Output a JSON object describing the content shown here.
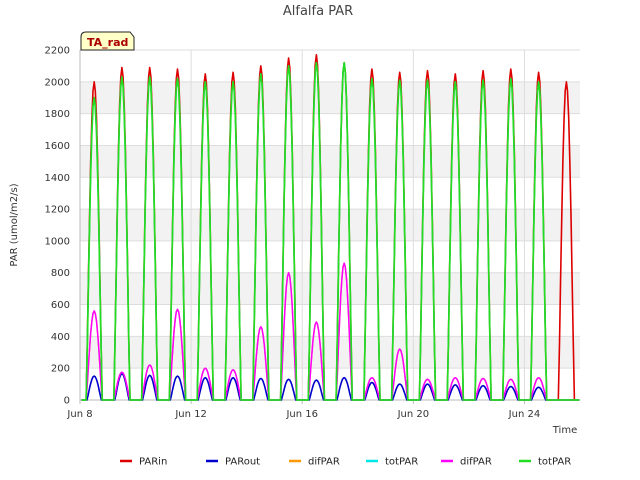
{
  "chart_data": {
    "type": "line",
    "title": "Alfalfa PAR",
    "xlabel": "Time",
    "ylabel": "PAR (umol/m2/s)",
    "badge": "TA_rad",
    "xlim": [
      "2024-06-08",
      "2024-06-26"
    ],
    "ylim": [
      0,
      2200
    ],
    "yticks": [
      0,
      200,
      400,
      600,
      800,
      1000,
      1200,
      1400,
      1600,
      1800,
      2000,
      2200
    ],
    "xticks": [
      {
        "date": "2024-06-08",
        "label": "Jun 8"
      },
      {
        "date": "2024-06-12",
        "label": "Jun 12"
      },
      {
        "date": "2024-06-16",
        "label": "Jun 16"
      },
      {
        "date": "2024-06-20",
        "label": "Jun 20"
      },
      {
        "date": "2024-06-24",
        "label": "Jun 24"
      }
    ],
    "grid": true,
    "legend_position": "bottom",
    "days": [
      "2024-06-08",
      "2024-06-09",
      "2024-06-10",
      "2024-06-11",
      "2024-06-12",
      "2024-06-13",
      "2024-06-14",
      "2024-06-15",
      "2024-06-16",
      "2024-06-17",
      "2024-06-18",
      "2024-06-19",
      "2024-06-20",
      "2024-06-21",
      "2024-06-22",
      "2024-06-23",
      "2024-06-24",
      "2024-06-25"
    ],
    "series": [
      {
        "name": "PARin",
        "color": "#dd0000",
        "daily_peak": [
          2000,
          2090,
          2090,
          2080,
          2050,
          2060,
          2100,
          2150,
          2170,
          2120,
          2080,
          2060,
          2070,
          2050,
          2070,
          2080,
          2060,
          2000
        ]
      },
      {
        "name": "PARout",
        "color": "#0000cc",
        "daily_peak": [
          150,
          165,
          155,
          150,
          140,
          140,
          135,
          130,
          125,
          140,
          110,
          100,
          100,
          95,
          90,
          85,
          80,
          0
        ]
      },
      {
        "name": "difPAR",
        "color": "#ff9900",
        "daily_peak": [
          560,
          175,
          220,
          570,
          200,
          190,
          460,
          800,
          490,
          860,
          140,
          320,
          130,
          140,
          135,
          130,
          140,
          0
        ]
      },
      {
        "name": "totPAR",
        "color": "#00e5e5",
        "daily_peak": [
          1900,
          2030,
          2030,
          2020,
          2000,
          2000,
          2050,
          2100,
          2120,
          2120,
          2020,
          2010,
          2010,
          2000,
          2010,
          2020,
          2000,
          0
        ]
      },
      {
        "name": "difPAR",
        "color": "#ff00ff",
        "daily_peak": [
          560,
          175,
          220,
          570,
          200,
          190,
          460,
          800,
          490,
          860,
          140,
          320,
          130,
          140,
          135,
          130,
          140,
          0
        ]
      },
      {
        "name": "totPAR",
        "color": "#22dd22",
        "daily_peak": [
          1900,
          2030,
          2030,
          2020,
          2000,
          2000,
          2050,
          2100,
          2120,
          2120,
          2020,
          2010,
          2010,
          2000,
          2010,
          2020,
          2000,
          0
        ]
      }
    ]
  }
}
